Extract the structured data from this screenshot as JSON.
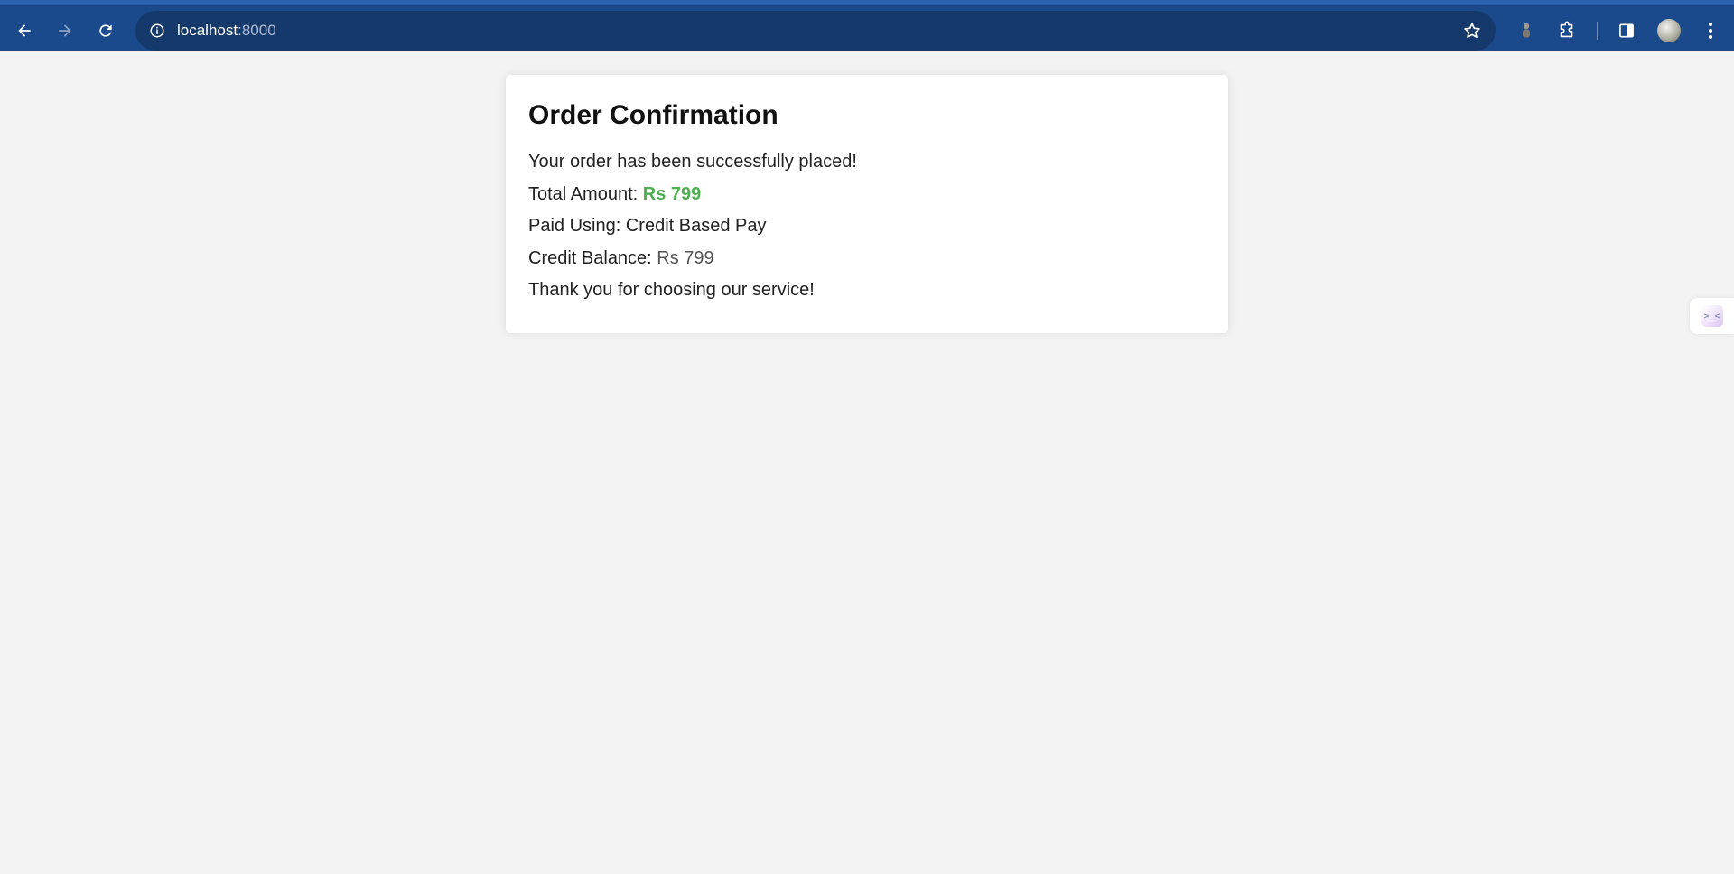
{
  "browser": {
    "url_host": "localhost",
    "url_port": ":8000",
    "icons": [
      "back-arrow-icon",
      "forward-arrow-icon",
      "reload-icon",
      "site-info-icon",
      "bookmark-star-icon",
      "extension-puzzle-icon",
      "side-panel-icon",
      "kebab-menu-icon"
    ]
  },
  "order": {
    "title": "Order Confirmation",
    "success_message": "Your order has been successfully placed!",
    "total_label": "Total Amount: ",
    "total_value": "Rs 799",
    "paid_label": "Paid Using: ",
    "paid_value": "Credit Based Pay",
    "balance_label": "Credit Balance: ",
    "balance_value": "Rs 799",
    "thanks": "Thank you for choosing our service!"
  },
  "side_tab": {
    "glyph": ">_<"
  },
  "colors": {
    "toolbar": "#1a4a8c",
    "omnibox": "#16396b",
    "page_background": "#f3f3f3",
    "amount_green": "#4caf50"
  }
}
